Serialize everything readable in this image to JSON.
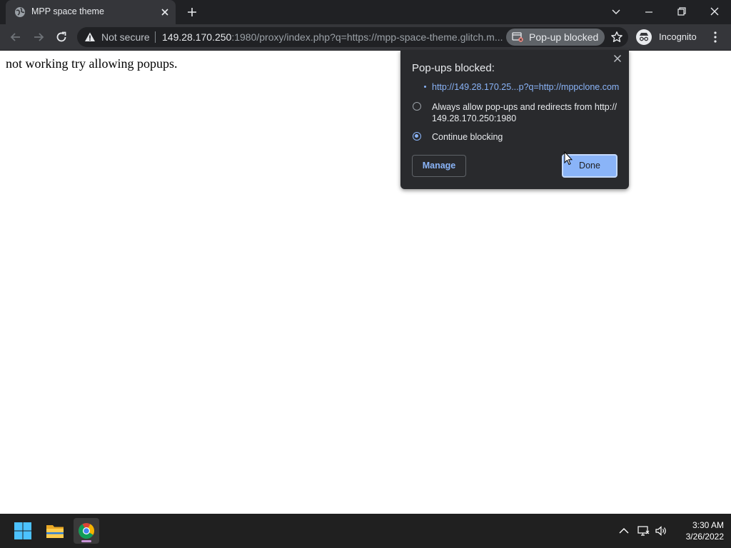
{
  "tab": {
    "title": "MPP space theme",
    "favicon": "globe-icon"
  },
  "window_controls": [
    "tab-search-icon",
    "minimize-icon",
    "restore-icon",
    "close-icon"
  ],
  "omnibox": {
    "security_label": "Not secure",
    "url_host": "149.28.170.250",
    "url_rest": ":1980/proxy/index.php?q=https://mpp-space-theme.glitch.m...",
    "popup_chip_label": "Pop-up blocked",
    "incognito_label": "Incognito"
  },
  "page": {
    "text": "not working try allowing popups."
  },
  "popup_bubble": {
    "title": "Pop-ups blocked:",
    "blocked_link": "http://149.28.170.25...p?q=http://mppclone.com",
    "option_allow": "Always allow pop-ups and redirects from http://",
    "option_allow_line2": "149.28.170.250:1980",
    "option_block": "Continue blocking",
    "selected_option": "Continue blocking",
    "manage_label": "Manage",
    "done_label": "Done"
  },
  "taskbar": {
    "apps": [
      "start-icon",
      "file-explorer-icon",
      "chrome-icon"
    ],
    "time": "3:30 AM",
    "date": "3/26/2022"
  },
  "colors": {
    "accent": "#8ab4f8",
    "frame": "#202124",
    "toolbar": "#35363a",
    "bubble": "#292a2d"
  }
}
